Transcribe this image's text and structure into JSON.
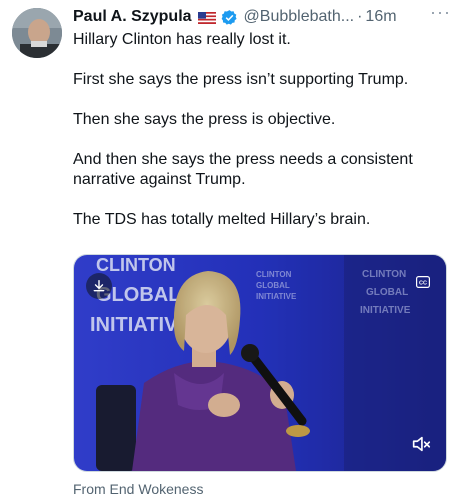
{
  "author": {
    "name": "Paul A. Szypula",
    "flag": "US flag",
    "verified": true,
    "handle": "@Bubblebath...",
    "separator": "·",
    "time": "16m",
    "more": "···"
  },
  "tweet": {
    "paragraphs": [
      "Hillary Clinton has really lost it.",
      "First she says the press isn’t supporting Trump.",
      "Then she says the press is objective.",
      "And then she says the press needs a consistent narrative against Trump.",
      "The TDS has totally melted Hillary’s brain."
    ]
  },
  "media": {
    "backdrop_text_left": [
      "CLINTON",
      "GLOBAL",
      "INITIATIV"
    ],
    "backdrop_text_mid": [
      "CLINTON",
      "GLOBAL",
      "INITIATIVE"
    ],
    "backdrop_text_right": [
      "CLINTON",
      "GLOBAL",
      "INITIATIVE"
    ],
    "cc_label": "CC",
    "icons": [
      "download-icon",
      "captions-icon",
      "mute-icon"
    ]
  },
  "source": "From End Wokeness",
  "colors": {
    "text": "#0f1419",
    "muted": "#536471",
    "verified": "#1d9bf0",
    "backdrop": "#2d3bd1"
  }
}
